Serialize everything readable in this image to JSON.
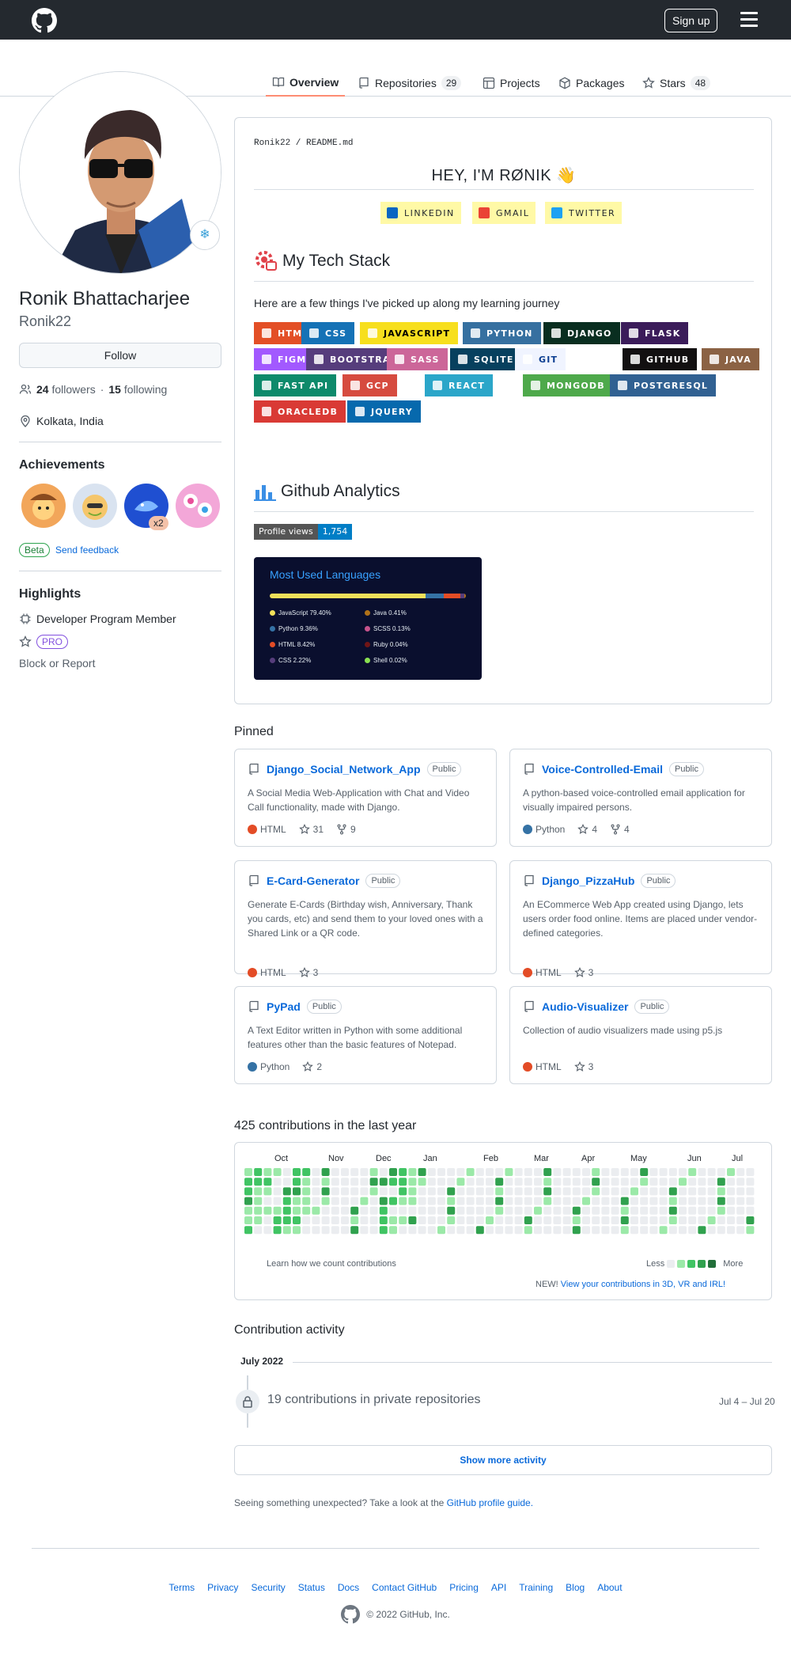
{
  "header": {
    "signup_label": "Sign up"
  },
  "tabs": [
    {
      "label": "Overview"
    },
    {
      "label": "Repositories",
      "count": "29"
    },
    {
      "label": "Projects"
    },
    {
      "label": "Packages"
    },
    {
      "label": "Stars",
      "count": "48"
    }
  ],
  "profile": {
    "full_name": "Ronik Bhattacharjee",
    "login": "Ronik22",
    "status_emoji": "❄",
    "follow_label": "Follow",
    "followers_count": "24",
    "followers_label": "followers",
    "following_count": "15",
    "following_label": "following",
    "location": "Kolkata, India",
    "achievements_title": "Achievements",
    "achievement_multiplier": "x2",
    "beta_label": "Beta",
    "feedback_label": "Send feedback",
    "highlights_title": "Highlights",
    "highlight_1": "Developer Program Member",
    "pro_label": "PRO",
    "block_label": "Block or Report"
  },
  "readme": {
    "path": "Ronik22 / README.md",
    "greeting": "HEY, I'M RØNIK 👋",
    "social": [
      "LINKEDIN",
      "GMAIL",
      "TWITTER"
    ],
    "tech_title": "My Tech Stack",
    "intro": "Here are a few things I've picked up along my learning journey",
    "badges": [
      "HTML",
      "CSS",
      "JAVASCRIPT",
      "PYTHON",
      "DJANGO",
      "FLASK",
      "FIGMA",
      "BOOTSTRAP",
      "SASS",
      "SQLITE",
      "GIT",
      "GITHUB",
      "JAVA",
      "FAST API",
      "GCP",
      "REACT",
      "MONGODB",
      "POSTGRESQL",
      "ORACLEDB",
      "JQUERY"
    ],
    "analytics_title": "Github Analytics",
    "profile_views_label": "Profile views",
    "profile_views_value": "1,754",
    "languages_title": "Most Used Languages",
    "languages": [
      {
        "name": "JavaScript",
        "pct": 79.4,
        "label": "JavaScript 79.40%",
        "color": "#f1e05a"
      },
      {
        "name": "Python",
        "pct": 9.36,
        "label": "Python 9.36%",
        "color": "#3572a5"
      },
      {
        "name": "HTML",
        "pct": 8.42,
        "label": "HTML 8.42%",
        "color": "#e34c26"
      },
      {
        "name": "CSS",
        "pct": 2.22,
        "label": "CSS 2.22%",
        "color": "#563d7c"
      },
      {
        "name": "Java",
        "pct": 0.41,
        "label": "Java 0.41%",
        "color": "#b07219"
      },
      {
        "name": "SCSS",
        "pct": 0.13,
        "label": "SCSS 0.13%",
        "color": "#c6538c"
      },
      {
        "name": "Ruby",
        "pct": 0.04,
        "label": "Ruby 0.04%",
        "color": "#701516"
      },
      {
        "name": "Shell",
        "pct": 0.02,
        "label": "Shell 0.02%",
        "color": "#89e051"
      }
    ]
  },
  "pinned": {
    "title": "Pinned",
    "public_label": "Public",
    "repos": [
      {
        "name": "Django_Social_Network_App",
        "desc": "A Social Media Web-Application with Chat and Video Call functionality, made with Django.",
        "lang": "HTML",
        "lang_color": "#e34c26",
        "stars": "31",
        "forks": "9"
      },
      {
        "name": "Voice-Controlled-Email",
        "desc": "A python-based voice-controlled email application for visually impaired persons.",
        "lang": "Python",
        "lang_color": "#3572a5",
        "stars": "4",
        "forks": "4"
      },
      {
        "name": "E-Card-Generator",
        "desc": "Generate E-Cards (Birthday wish, Anniversary, Thank you cards, etc) and send them to your loved ones with a Shared Link or a QR code.",
        "lang": "HTML",
        "lang_color": "#e34c26",
        "stars": "3",
        "forks": ""
      },
      {
        "name": "Django_PizzaHub",
        "desc": "An ECommerce Web App created using Django, lets users order food online. Items are placed under vendor-defined categories.",
        "lang": "HTML",
        "lang_color": "#e34c26",
        "stars": "3",
        "forks": ""
      },
      {
        "name": "PyPad",
        "desc": "A Text Editor written in Python with some additional features other than the basic features of Notepad.",
        "lang": "Python",
        "lang_color": "#3572a5",
        "stars": "2",
        "forks": ""
      },
      {
        "name": "Audio-Visualizer",
        "desc": "Collection of audio visualizers made using p5.js",
        "lang": "HTML",
        "lang_color": "#e34c26",
        "stars": "3",
        "forks": ""
      }
    ]
  },
  "contributions": {
    "title": "425 contributions in the last year",
    "months": [
      "Oct",
      "Nov",
      "Dec",
      "Jan",
      "Feb",
      "Mar",
      "Apr",
      "May",
      "Jun",
      "Jul"
    ],
    "learn_label": "Learn how we count contributions",
    "less_label": "Less",
    "more_label": "More",
    "new_prefix": "NEW!",
    "new_link": "View your contributions in 3D, VR and IRL!",
    "level_colors": [
      "#ebedf0",
      "#9be9a8",
      "#40c463",
      "#30a14e",
      "#216e39"
    ]
  },
  "activity": {
    "title": "Contribution activity",
    "month": "July 2022",
    "private_text": "19 contributions in private repositories",
    "date_range": "Jul 4 – Jul 20",
    "show_more": "Show more activity",
    "unexpected_text": "Seeing something unexpected? Take a look at the",
    "guide_link": "GitHub profile guide."
  },
  "footer": {
    "links": [
      "Terms",
      "Privacy",
      "Security",
      "Status",
      "Docs",
      "Contact GitHub",
      "Pricing",
      "API",
      "Training",
      "Blog",
      "About"
    ],
    "copyright": "© 2022 GitHub, Inc."
  }
}
